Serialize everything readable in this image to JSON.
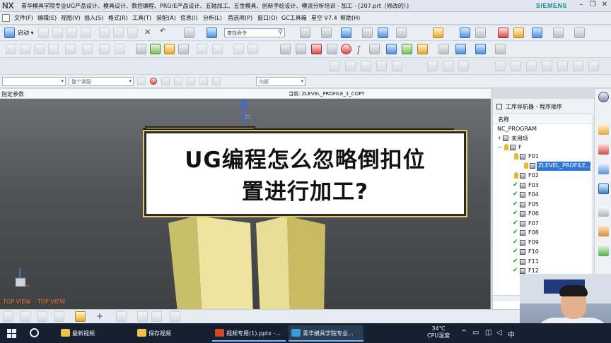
{
  "window": {
    "logo": "NX",
    "title": "青华模具学院专业UG产品设计、模具设计、数控编程、PRO/E产品设计、五轴加工、五金模具、创新手绘设计、模流分析培训 - 加工 - [207.prt（修改的）]",
    "brand": "SIEMENS"
  },
  "menu": {
    "items": [
      "文件(F)",
      "编辑(E)",
      "视图(V)",
      "插入(S)",
      "格式(R)",
      "工具(T)",
      "装配(A)",
      "信息(I)",
      "分析(L)",
      "首选项(P)",
      "窗口(O)",
      "GC工具箱",
      "星空 V7.4",
      "帮助(H)"
    ]
  },
  "toolbar": {
    "start_label": "启动 ▾",
    "command_search_placeholder": "查找命令"
  },
  "selection_bar": {
    "filter_value": "整个装配",
    "scope_value": "内部"
  },
  "status": {
    "prompt": "指定参数",
    "current_label": "当前: ZLEVEL_PROFILE_1_COPY"
  },
  "viewport": {
    "overlay_line1": "UG编程怎么忽略倒扣位",
    "overlay_line2": "置进行加工?",
    "view_label_1": "TOP VIEW",
    "view_label_2": "TOP VIEW",
    "axis_label": "ZC"
  },
  "navigator": {
    "title": "工序导航器 - 程序顺序",
    "column": "名称",
    "root": "NC_PROGRAM",
    "unused": "未用项",
    "group": "F",
    "selected_op": "ZLEVEL_PROFILE...",
    "programs": [
      "F01",
      "F02",
      "F03",
      "F04",
      "F05",
      "F06",
      "F07",
      "F08",
      "F09",
      "F10",
      "F11",
      "F12"
    ]
  },
  "taskbar": {
    "items": [
      "最新视频",
      "保存视频",
      "视频专用(1).pptx -...",
      "青华模具学院专业..."
    ],
    "temperature": "34℃",
    "temperature_label": "CPU温度",
    "ime": "中"
  },
  "colors": {
    "selection": "#2f78d8",
    "check": "#1a9f1a",
    "overlay_back": "#f5d66c",
    "viewport_label": "#f06d2f",
    "taskbar": "#152031"
  }
}
